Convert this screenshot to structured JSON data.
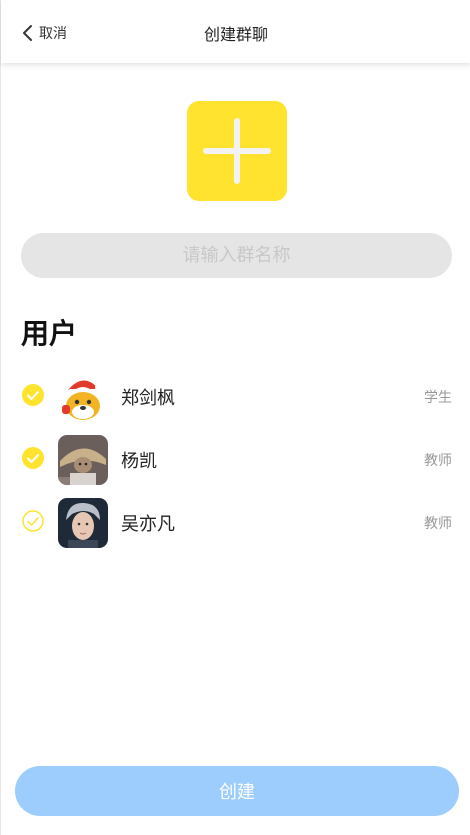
{
  "header": {
    "back_label": "取消",
    "title": "创建群聊"
  },
  "group_avatar": {
    "icon": "plus-icon",
    "color": "#ffe32e"
  },
  "group_name": {
    "value": "",
    "placeholder": "请输入群名称"
  },
  "section_title": "用户",
  "users": [
    {
      "name": "郑剑枫",
      "role": "学生",
      "selected": true,
      "avatar": "santa-mascot-avatar"
    },
    {
      "name": "杨凯",
      "role": "教师",
      "selected": true,
      "avatar": "bear-straw-hat-avatar"
    },
    {
      "name": "吴亦凡",
      "role": "教师",
      "selected": false,
      "avatar": "portrait-avatar"
    }
  ],
  "create_label": "创建",
  "colors": {
    "accent": "#ffe32e",
    "button": "#9dcdfd"
  }
}
